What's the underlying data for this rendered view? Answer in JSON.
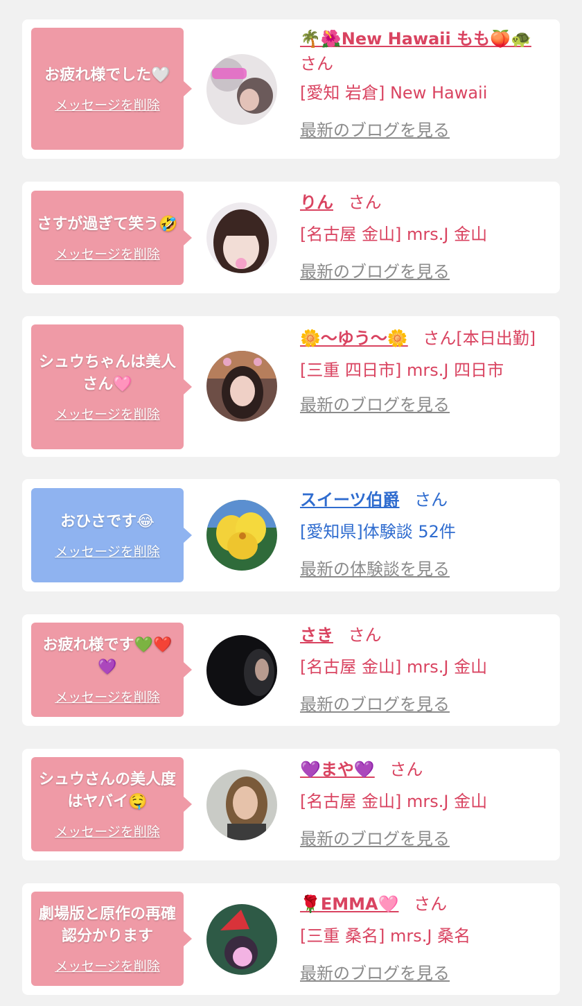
{
  "items": [
    {
      "message": "お疲れ様でした🤍",
      "delete_label": "メッセージを削除",
      "name": "🌴🌺New Hawaii もも🍑🐢",
      "san": "さん",
      "shop": "[愛知 岩倉] New Hawaii",
      "blog_link": "最新のブログを見る",
      "theme": "pink"
    },
    {
      "message": "さすが過ぎて笑う🤣",
      "delete_label": "メッセージを削除",
      "name": "りん",
      "san": "さん",
      "shop": "[名古屋 金山] mrs.J 金山",
      "blog_link": "最新のブログを見る",
      "theme": "pink"
    },
    {
      "message": "シュウちゃんは美人さん🩷",
      "delete_label": "メッセージを削除",
      "name": "🌼〜ゆう〜🌼",
      "san": "さん[本日出勤]",
      "shop": "[三重 四日市] mrs.J 四日市",
      "blog_link": "最新のブログを見る",
      "theme": "pink"
    },
    {
      "message": "おひさです😂",
      "delete_label": "メッセージを削除",
      "name": "スイーツ伯爵",
      "san": "さん",
      "shop": "[愛知県]体験談 52件",
      "blog_link": "最新の体験談を見る",
      "theme": "blue"
    },
    {
      "message": "お疲れ様です💚❤️💜",
      "delete_label": "メッセージを削除",
      "name": "さき",
      "san": "さん",
      "shop": "[名古屋 金山] mrs.J 金山",
      "blog_link": "最新のブログを見る",
      "theme": "pink"
    },
    {
      "message": "シュウさんの美人度はヤバイ🤤",
      "delete_label": "メッセージを削除",
      "name": "💜まや💜",
      "san": "さん",
      "shop": "[名古屋 金山] mrs.J 金山",
      "blog_link": "最新のブログを見る",
      "theme": "pink"
    },
    {
      "message": "劇場版と原作の再確認分かります",
      "delete_label": "メッセージを削除",
      "name": "🌹EMMA🩷",
      "san": "さん",
      "shop": "[三重 桑名] mrs.J 桑名",
      "blog_link": "最新のブログを見る",
      "theme": "pink"
    }
  ],
  "colors": {
    "pink_bubble": "#ef9aa6",
    "blue_bubble": "#8fb3f0",
    "name_red": "#d94360",
    "name_blue": "#2f6ccf",
    "link_gray": "#8b8b8b",
    "background": "#f1f1f1"
  }
}
